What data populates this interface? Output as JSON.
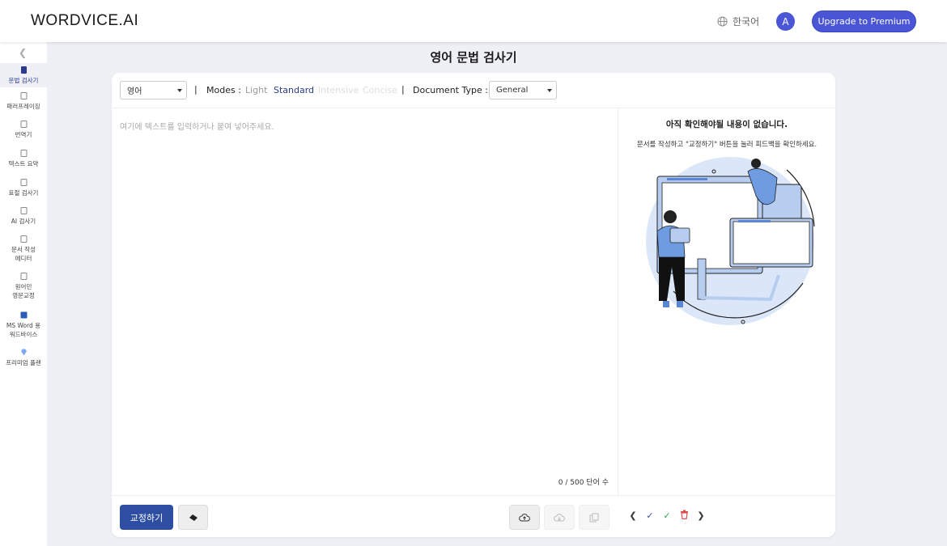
{
  "header": {
    "logo": "WORDVICE.AI",
    "language": "한국어",
    "avatar_letter": "A",
    "upgrade_label": "Upgrade to Premium",
    "accent_color": "#4a56d6"
  },
  "page_title": "영어 문법 검사기",
  "sidebar": {
    "items": [
      {
        "label": "문법 검사기",
        "icon": "grammar-icon",
        "active": true
      },
      {
        "label": "패러프레이징",
        "icon": "paraphrase-icon"
      },
      {
        "label": "번역기",
        "icon": "translate-icon"
      },
      {
        "label": "텍스트 요약",
        "icon": "summary-icon"
      },
      {
        "label": "표절 검사기",
        "icon": "plagiarism-icon"
      },
      {
        "label": "AI 검사기",
        "icon": "ai-detector-icon"
      },
      {
        "label": "문서 작성\n에디터",
        "icon": "document-editor-icon"
      },
      {
        "label": "원어민\n영문교정",
        "icon": "external-link-icon"
      },
      {
        "label": "MS Word 용\n워드바이스",
        "icon": "ms-word-icon"
      },
      {
        "label": "프리미엄 플랜",
        "icon": "diamond-icon"
      }
    ]
  },
  "toolbar": {
    "language_select": "영어",
    "separator": "|",
    "modes_label": "Modes :",
    "modes": [
      {
        "label": "Light",
        "state": "available"
      },
      {
        "label": "Standard",
        "state": "selected"
      },
      {
        "label": "Intensive",
        "state": "disabled"
      },
      {
        "label": "Concise",
        "state": "disabled"
      }
    ],
    "doc_type_label": "Document Type :",
    "doc_type_value": "General"
  },
  "editor": {
    "placeholder": "여기에 텍스트를 입력하거나 붙여 넣어주세요.",
    "word_count": "0 / 500 단어 수"
  },
  "right_panel": {
    "title": "아직 확인해야될 내용이 없습니다.",
    "subtitle": "문서를 작성하고 \"교정하기\" 버튼을 눌러 피드백을 확인하세요."
  },
  "bottom_bar": {
    "correct_label": "교정하기",
    "actions": [
      "prev",
      "accept",
      "accept-all",
      "delete",
      "next"
    ]
  },
  "colors": {
    "primary": "#2d4ea3",
    "selected_mode": "#2b3a8f",
    "illustration": "#b7cdf0"
  }
}
